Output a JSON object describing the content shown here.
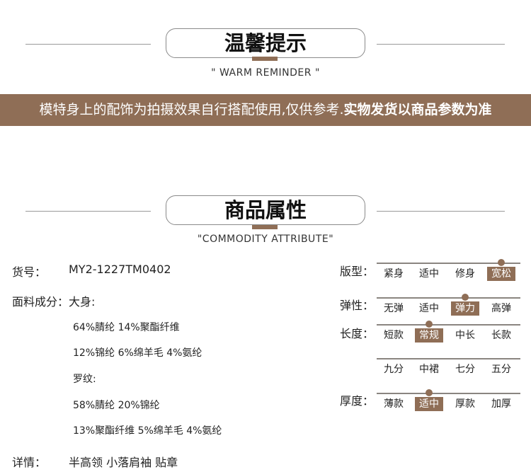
{
  "reminder": {
    "title": "温馨提示",
    "subtitle": "\" WARM REMINDER \"",
    "banner_normal": "模特身上的配饰为拍摄效果自行搭配使用,仅供参考.",
    "banner_bold": "实物发货以商品参数为准"
  },
  "attribute": {
    "title": "商品属性",
    "subtitle": "\"COMMODITY ATTRIBUTE\""
  },
  "left": {
    "item_no_label": "货号：",
    "item_no": "MY2-1227TM0402",
    "fabric_label": "面料成分：大身:",
    "fabric_lines": [
      "64%腈纶 14%聚酯纤维",
      "12%锦纶 6%绵羊毛 4%氨纶",
      "罗纹:",
      "58%腈纶 20%锦纶",
      "13%聚酯纤维 5%绵羊毛 4%氨纶"
    ],
    "detail_label": "详情：",
    "detail": "半高领 小落肩袖 贴章"
  },
  "scales": [
    {
      "label": "版型：",
      "options": [
        "紧身",
        "适中",
        "修身",
        "宽松"
      ],
      "selected": 3
    },
    {
      "label": "弹性：",
      "options": [
        "无弹",
        "适中",
        "弹力",
        "高弹"
      ],
      "selected": 2
    },
    {
      "label": "长度：",
      "options": [
        "短款",
        "常规",
        "中长",
        "长款"
      ],
      "selected": 1
    },
    {
      "label": "",
      "options": [
        "九分",
        "中裙",
        "七分",
        "五分"
      ],
      "selected": -1
    },
    {
      "label": "厚度：",
      "options": [
        "薄款",
        "适中",
        "厚款",
        "加厚"
      ],
      "selected": 1
    }
  ],
  "colors": {
    "accent": "#8f6e56"
  }
}
